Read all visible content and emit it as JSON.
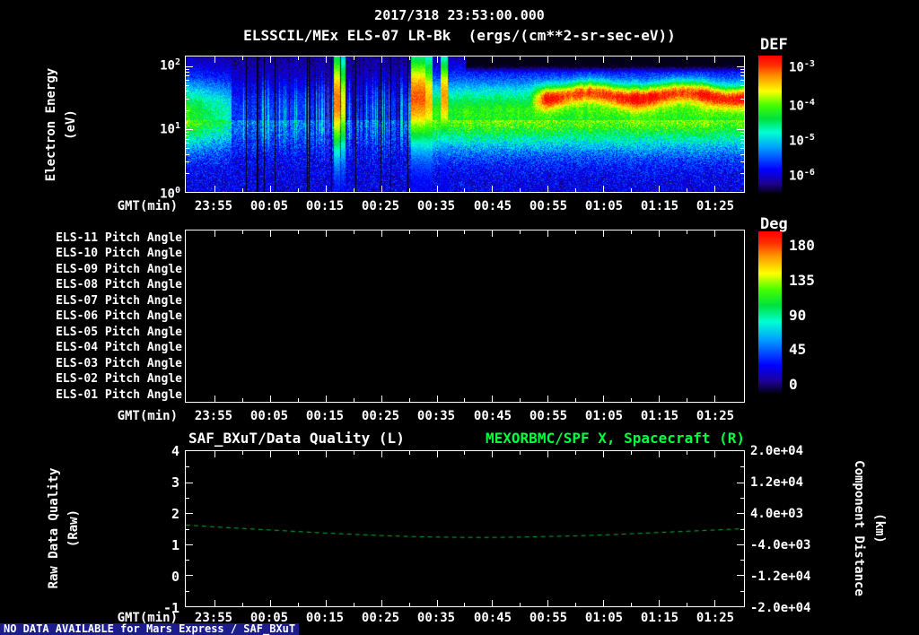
{
  "colors": {
    "background": "#000000",
    "foreground": "#ffffff",
    "title_right_green": "#00ff41",
    "line_green": "#00b43c",
    "footer_bg": "#1c1c8c"
  },
  "colormap": {
    "colors": [
      "#030018",
      "#1e0096",
      "#0000ff",
      "#00a0ff",
      "#00ffd2",
      "#00e13c",
      "#46ff00",
      "#ffff00",
      "#ff9100",
      "#ff2d00",
      "#ff0000"
    ],
    "stops": [
      0,
      0.07,
      0.17,
      0.33,
      0.44,
      0.54,
      0.64,
      0.74,
      0.85,
      0.93,
      1
    ]
  },
  "header": {
    "timestamp": "2017/318 23:53:00.000",
    "title": "ELSSCIL/MEx ELS-07 LR-Bk  (ergs/(cm**2-sr-sec-eV))"
  },
  "footer": {
    "no_data": "NO DATA AVAILABLE for Mars Express / SAF_BXuT"
  },
  "chart_data": [
    {
      "type": "heatmap",
      "name": "electron-energy-spectrogram",
      "instrument": "ELSSCIL/MEx ELS-07 LR-Bk",
      "units": "ergs/(cm**2-sr-sec-eV)",
      "xlabel": "GMT(min)",
      "x_ticks": [
        "23:55",
        "00:05",
        "00:15",
        "00:25",
        "00:35",
        "00:45",
        "00:55",
        "01:05",
        "01:15",
        "01:25"
      ],
      "x_tick_fracs": [
        0.0513,
        0.1508,
        0.2503,
        0.3498,
        0.4494,
        0.5489,
        0.6484,
        0.7479,
        0.8474,
        0.947
      ],
      "ylabel": "Electron Energy",
      "ylabel_units": "(eV)",
      "y_scale": "log",
      "y_ticks": [
        {
          "base": "10",
          "exp": "2",
          "frac": 0.065
        },
        {
          "base": "10",
          "exp": "1",
          "frac": 0.533
        },
        {
          "base": "10",
          "exp": "0",
          "frac": 1.0
        }
      ],
      "colorbar": {
        "label": "DEF",
        "ticks": [
          {
            "base": "10",
            "exp": "-3",
            "frac": 0.085
          },
          {
            "base": "10",
            "exp": "-4",
            "frac": 0.366
          },
          {
            "base": "10",
            "exp": "-5",
            "frac": 0.62
          },
          {
            "base": "10",
            "exp": "-6",
            "frac": 0.876
          }
        ]
      },
      "features": {
        "value_log10_range": [
          -6.5,
          -3.0
        ],
        "logE_top": 2.15,
        "mid_band": {
          "logE_center": 1.25,
          "sigma": 0.55
        },
        "left_blob": {
          "t_end": 0.081,
          "amp": 0.95
        },
        "sparse_region": {
          "t_start": 0.09,
          "t_end": 0.4,
          "amp": 0.28,
          "deep_dark_t_start": 0.22
        },
        "stripes": [
          {
            "t": 0.27,
            "w": 0.006,
            "amp": 1.2,
            "center": 1.45,
            "sigma": 0.85
          },
          {
            "t": 0.282,
            "w": 0.004,
            "amp": 1.0,
            "center": 1.4,
            "sigma": 0.8
          },
          {
            "t": 0.415,
            "w": 0.013,
            "amp": 1.25,
            "center": 1.5,
            "sigma": 0.75
          },
          {
            "t": 0.433,
            "w": 0.008,
            "amp": 1.1,
            "center": 1.45,
            "sigma": 0.75
          },
          {
            "t": 0.462,
            "w": 0.007,
            "amp": 1.15,
            "center": 1.5,
            "sigma": 0.7
          }
        ],
        "green_field": {
          "t_start": 0.44,
          "amp": 0.92
        },
        "red_band": {
          "t_start": 0.615,
          "logE_center": 1.55,
          "sigma": 0.17,
          "amp": 1.75
        }
      }
    },
    {
      "type": "heatmap",
      "name": "pitch-angle-panels",
      "data": "empty",
      "rows": [
        "ELS-11 Pitch Angle",
        "ELS-10 Pitch Angle",
        "ELS-09 Pitch Angle",
        "ELS-08 Pitch Angle",
        "ELS-07 Pitch Angle",
        "ELS-06 Pitch Angle",
        "ELS-05 Pitch Angle",
        "ELS-04 Pitch Angle",
        "ELS-03 Pitch Angle",
        "ELS-02 Pitch Angle",
        "ELS-01 Pitch Angle"
      ],
      "xlabel": "GMT(min)",
      "x_ticks": [
        "23:55",
        "00:05",
        "00:15",
        "00:25",
        "00:35",
        "00:45",
        "00:55",
        "01:05",
        "01:15",
        "01:25"
      ],
      "x_tick_fracs": [
        0.0513,
        0.1508,
        0.2503,
        0.3498,
        0.4494,
        0.5489,
        0.6484,
        0.7479,
        0.8474,
        0.947
      ],
      "colorbar": {
        "label": "Deg",
        "ticks": [
          {
            "v": "180",
            "frac": 0.085
          },
          {
            "v": "135",
            "frac": 0.3
          },
          {
            "v": "90",
            "frac": 0.515
          },
          {
            "v": "45",
            "frac": 0.73
          },
          {
            "v": "0",
            "frac": 0.945
          }
        ]
      }
    },
    {
      "type": "line",
      "name": "data-quality-and-spacecraft-position",
      "title_left": "SAF_BXuT/Data Quality (L)",
      "title_right": "MEXORBMC/SPF X, Spacecraft (R)",
      "xlabel": "GMT(min)",
      "x_ticks": [
        "23:55",
        "00:05",
        "00:15",
        "00:25",
        "00:35",
        "00:45",
        "00:55",
        "01:05",
        "01:15",
        "01:25"
      ],
      "x_tick_fracs": [
        0.0513,
        0.1508,
        0.2503,
        0.3498,
        0.4494,
        0.5489,
        0.6484,
        0.7479,
        0.8474,
        0.947
      ],
      "ylabel_left": "Raw Data Quality",
      "ylabel_left_units": "(Raw)",
      "ylim_left": [
        -1,
        4
      ],
      "y_ticks_left": [
        "4",
        "3",
        "2",
        "1",
        "0",
        "-1"
      ],
      "ylabel_right": "Component Distance",
      "ylabel_right_units": "(km)",
      "ylim_right": [
        -20000,
        20000
      ],
      "y_ticks_right": [
        "2.0e+04",
        "1.2e+04",
        "4.0e+03",
        "-4.0e+03",
        "-1.2e+04",
        "-2.0e+04"
      ],
      "series": [
        {
          "name": "MEXORBMC/SPF X Spacecraft",
          "style": "dashed",
          "x_frac": [
            0,
            0.05,
            0.1,
            0.15,
            0.2,
            0.25,
            0.3,
            0.35,
            0.4,
            0.45,
            0.5,
            0.55,
            0.6,
            0.65,
            0.7,
            0.75,
            0.8,
            0.85,
            0.9,
            0.95,
            1
          ],
          "y_left_units": [
            1.62,
            1.56,
            1.51,
            1.46,
            1.41,
            1.36,
            1.32,
            1.28,
            1.25,
            1.23,
            1.22,
            1.22,
            1.23,
            1.25,
            1.27,
            1.3,
            1.34,
            1.38,
            1.42,
            1.46,
            1.5
          ]
        }
      ]
    }
  ]
}
